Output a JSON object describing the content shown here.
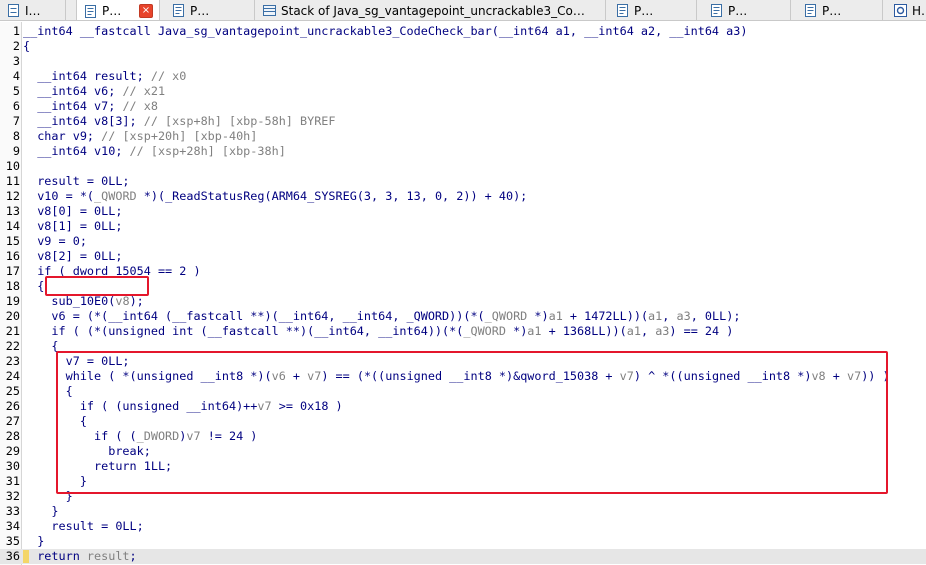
{
  "tabs": [
    {
      "label": "I…",
      "icon": "list-icon",
      "active": false
    },
    {
      "label": "P…",
      "icon": "pseudocode-icon",
      "active": true,
      "close": "×"
    },
    {
      "label": "P…",
      "icon": "pseudocode-icon",
      "active": false
    },
    {
      "label": "P…",
      "icon": "pseudocode-icon",
      "active": false
    },
    {
      "label": "Stack of Java_sg_vantagepoint_uncrackable3_Co…",
      "icon": "stack-icon",
      "active": false
    },
    {
      "label": "P…",
      "icon": "pseudocode-icon",
      "active": false
    },
    {
      "label": "P…",
      "icon": "pseudocode-icon",
      "active": false
    },
    {
      "label": "P…",
      "icon": "pseudocode-icon",
      "active": false
    },
    {
      "label": "H…",
      "icon": "hex-icon",
      "active": false
    }
  ],
  "code": {
    "current_line": 36,
    "lines": [
      [
        [
          "n",
          "__int64 __fastcall Java_sg_vantagepoint_uncrackable3_CodeCheck_bar(__int64 a1, __int64 a2, __int64 a3)"
        ]
      ],
      [
        [
          "n",
          "{"
        ]
      ],
      [
        [
          "n",
          ""
        ]
      ],
      [
        [
          "n",
          "  __int64 result; "
        ],
        [
          "g",
          "// x0"
        ]
      ],
      [
        [
          "n",
          "  __int64 v6; "
        ],
        [
          "g",
          "// x21"
        ]
      ],
      [
        [
          "n",
          "  __int64 v7; "
        ],
        [
          "g",
          "// x8"
        ]
      ],
      [
        [
          "n",
          "  __int64 v8[3]; "
        ],
        [
          "g",
          "// [xsp+8h] [xbp-58h] BYREF"
        ]
      ],
      [
        [
          "n",
          "  char v9; "
        ],
        [
          "g",
          "// [xsp+20h] [xbp-40h]"
        ]
      ],
      [
        [
          "n",
          "  __int64 v10; "
        ],
        [
          "g",
          "// [xsp+28h] [xbp-38h]"
        ]
      ],
      [
        [
          "n",
          ""
        ]
      ],
      [
        [
          "n",
          "  result = 0LL;"
        ]
      ],
      [
        [
          "n",
          "  v10 = *("
        ],
        [
          "g",
          "_QWORD"
        ],
        [
          "n",
          " *)(_ReadStatusReg(ARM64_SYSREG(3, 3, 13, 0, 2)) + 40);"
        ]
      ],
      [
        [
          "n",
          "  v8[0] = 0LL;"
        ]
      ],
      [
        [
          "n",
          "  v8[1] = 0LL;"
        ]
      ],
      [
        [
          "n",
          "  v9 = 0;"
        ]
      ],
      [
        [
          "n",
          "  v8[2] = 0LL;"
        ]
      ],
      [
        [
          "n",
          "  if ( dword_15054 == 2 )"
        ]
      ],
      [
        [
          "n",
          "  {"
        ]
      ],
      [
        [
          "n",
          "    sub_10E0("
        ],
        [
          "g",
          "v8"
        ],
        [
          "n",
          ");"
        ]
      ],
      [
        [
          "n",
          "    v6 = (*(__int64 (__fastcall **)(__int64, __int64, _QWORD))(*("
        ],
        [
          "g",
          "_QWORD"
        ],
        [
          "n",
          " *)"
        ],
        [
          "g",
          "a1"
        ],
        [
          "n",
          " + 1472LL))("
        ],
        [
          "g",
          "a1"
        ],
        [
          "n",
          ", "
        ],
        [
          "g",
          "a3"
        ],
        [
          "n",
          ", 0LL);"
        ]
      ],
      [
        [
          "n",
          "    if ( (*(unsigned int (__fastcall **)(__int64, __int64))(*("
        ],
        [
          "g",
          "_QWORD"
        ],
        [
          "n",
          " *)"
        ],
        [
          "g",
          "a1"
        ],
        [
          "n",
          " + 1368LL))("
        ],
        [
          "g",
          "a1"
        ],
        [
          "n",
          ", "
        ],
        [
          "g",
          "a3"
        ],
        [
          "n",
          ") == 24 )"
        ]
      ],
      [
        [
          "n",
          "    {"
        ]
      ],
      [
        [
          "n",
          "      v7 = 0LL;"
        ]
      ],
      [
        [
          "n",
          "      while ( *(unsigned __int8 *)("
        ],
        [
          "g",
          "v6"
        ],
        [
          "n",
          " + "
        ],
        [
          "g",
          "v7"
        ],
        [
          "n",
          ") == (*((unsigned __int8 *)&qword_15038 + "
        ],
        [
          "g",
          "v7"
        ],
        [
          "n",
          ") ^ *((unsigned __int8 *)"
        ],
        [
          "g",
          "v8"
        ],
        [
          "n",
          " + "
        ],
        [
          "g",
          "v7"
        ],
        [
          "n",
          ")) )"
        ]
      ],
      [
        [
          "n",
          "      {"
        ]
      ],
      [
        [
          "n",
          "        if ( (unsigned __int64)++"
        ],
        [
          "g",
          "v7"
        ],
        [
          "n",
          " >= 0x18 )"
        ]
      ],
      [
        [
          "n",
          "        {"
        ]
      ],
      [
        [
          "n",
          "          if ( ("
        ],
        [
          "g",
          "_DWORD"
        ],
        [
          "n",
          ")"
        ],
        [
          "g",
          "v7"
        ],
        [
          "n",
          " != 24 )"
        ]
      ],
      [
        [
          "n",
          "            break;"
        ]
      ],
      [
        [
          "n",
          "          return 1LL;"
        ]
      ],
      [
        [
          "n",
          "        }"
        ]
      ],
      [
        [
          "n",
          "      }"
        ]
      ],
      [
        [
          "n",
          "    }"
        ]
      ],
      [
        [
          "n",
          "    result = 0LL;"
        ]
      ],
      [
        [
          "n",
          "  }"
        ]
      ],
      [
        [
          "n",
          "  return "
        ],
        [
          "g",
          "result"
        ],
        [
          "n",
          ";"
        ]
      ],
      [
        [
          "n",
          "}"
        ]
      ]
    ]
  },
  "colors": {
    "annotation_box": "#e4172c",
    "current_line_bg": "#e6e6e6",
    "code_text": "#000080",
    "comment_text": "#808080"
  }
}
